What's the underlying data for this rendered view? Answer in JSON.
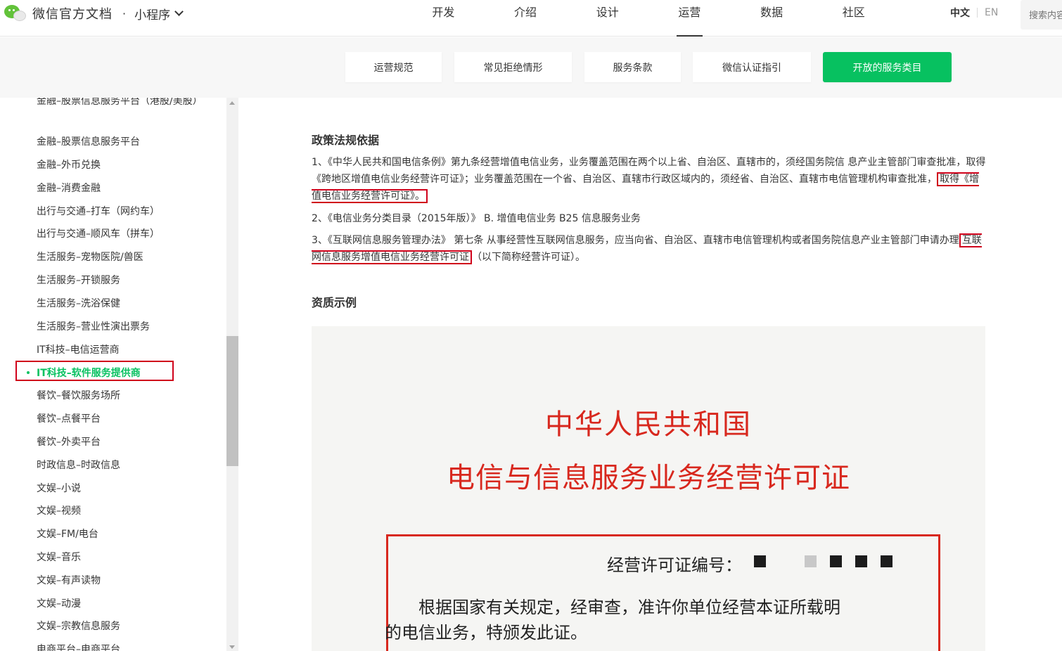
{
  "header": {
    "brand_title": "微信官方文档",
    "brand_dot": "·",
    "brand_sub": "小程序",
    "nav": [
      "开发",
      "介绍",
      "设计",
      "运营",
      "数据",
      "社区"
    ],
    "active_nav": "运营",
    "lang_zh": "中文",
    "lang_en": "EN",
    "search_placeholder": "搜索内容"
  },
  "subnav": {
    "items": [
      "运营规范",
      "常见拒绝情形",
      "服务条款",
      "微信认证指引",
      "开放的服务类目"
    ],
    "active": "开放的服务类目"
  },
  "sidebar": {
    "items": [
      "金融–股票信息服务平台（港股/美股）",
      "金融–股票信息服务平台",
      "金融–外币兑换",
      "金融–消费金融",
      "出行与交通–打车（网约车）",
      "出行与交通–顺风车（拼车）",
      "生活服务–宠物医院/兽医",
      "生活服务–开锁服务",
      "生活服务–洗浴保健",
      "生活服务–营业性演出票务",
      "IT科技–电信运营商",
      "IT科技–软件服务提供商",
      "餐饮–餐饮服务场所",
      "餐饮–点餐平台",
      "餐饮–外卖平台",
      "时政信息–时政信息",
      "文娱–小说",
      "文娱–视频",
      "文娱–FM/电台",
      "文娱–音乐",
      "文娱–有声读物",
      "文娱–动漫",
      "文娱–宗教信息服务",
      "电商平台–电商平台"
    ],
    "active_item": "IT科技–软件服务提供商"
  },
  "content": {
    "section1_title": "政策法规依据",
    "p1_a": "1、《中华人民共和国电信条例》第九条",
    "p1_b": "经营增值电信业务，业务覆盖范围在两个以上省、自治区、直辖市的，须经国务院信 息产业主管部门审查批准，取得《跨地区增值电信业务经营许可证》；业务覆盖范围在一个省、自治区、直辖市行政区域内的，须经省、自治区、直辖市电信管理机构审查批准，",
    "p1_hl": "取得《增值电信业务经营许可证》。",
    "p2_a": "2、《电信业务分类目录（2015年版）》",
    "p2_b": " B. 增值电信业务 B25 信息服务业务",
    "p3_a": "3、《互联网信息服务管理办法》 第七条",
    "p3_b": " 从事经营性互联网信息服务，应当向省、自治区、直辖市电信管理机构或者国务院信息产业主管部门申请办理",
    "p3_hl": "互联网信息服务增值电信业务经营许可证",
    "p3_c": "（以下简称经营许可证）。",
    "section2_title": "资质示例"
  },
  "certificate": {
    "title1": "中华人民共和国",
    "title2": "电信与信息服务业务经营许可证",
    "number_label": "经营许可证编号：",
    "text1": "根据国家有关规定，经审查，准许你单位经营本证所载明",
    "text2": "的电信业务，特颁发此证。"
  },
  "colors": {
    "accent": "#07c160",
    "highlight": "#d0021b",
    "cert_red": "#d8281e"
  }
}
